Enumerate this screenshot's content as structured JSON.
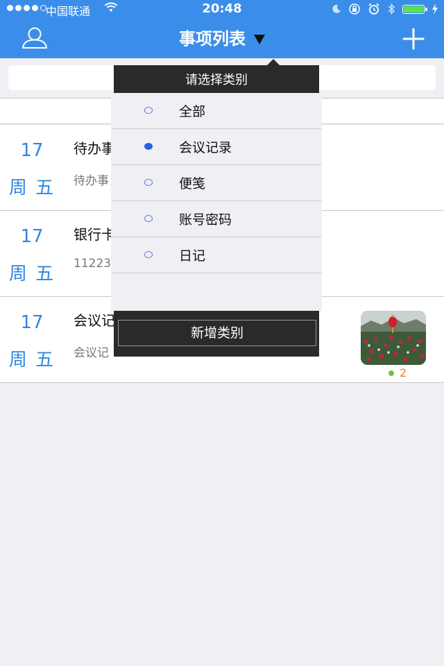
{
  "status_bar": {
    "carrier": "中国联通",
    "time": "20:48"
  },
  "nav": {
    "title": "事项列表",
    "icons": {
      "left": "user-icon",
      "right": "plus-icon",
      "title_caret": "triangle-down-icon"
    }
  },
  "items": [
    {
      "day": "17",
      "weekday": "周 五",
      "title": "待办事",
      "subtitle": "待办事"
    },
    {
      "day": "17",
      "weekday": "周 五",
      "title": "银行卡",
      "subtitle": "11223"
    },
    {
      "day": "17",
      "weekday": "周 五",
      "title": "会议记",
      "subtitle": "会议记",
      "attachment_count": "2"
    }
  ],
  "popover": {
    "header": "请选择类别",
    "options": [
      {
        "label": "全部",
        "selected": false
      },
      {
        "label": "会议记录",
        "selected": true
      },
      {
        "label": "便笺",
        "selected": false
      },
      {
        "label": "账号密码",
        "selected": false
      },
      {
        "label": "日记",
        "selected": false
      }
    ],
    "add_button": "新增类别"
  },
  "colors": {
    "nav_bg": "#3a8eea",
    "accent_blue": "#2f87e0",
    "popover_dark": "#2a2a2a",
    "selected_radio": "#2a5fe0",
    "attachment_count": "#f07a2a"
  }
}
